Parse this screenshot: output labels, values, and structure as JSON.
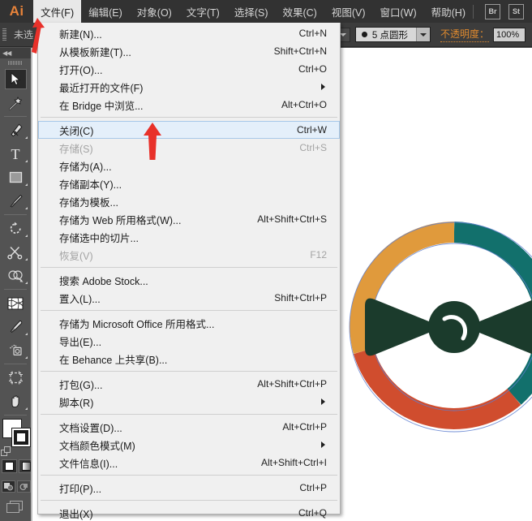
{
  "app": {
    "logo": "Ai",
    "accent_orange": "#e8833a"
  },
  "menubar": {
    "items": [
      {
        "label": "文件(F)",
        "active": true
      },
      {
        "label": "编辑(E)",
        "active": false
      },
      {
        "label": "对象(O)",
        "active": false
      },
      {
        "label": "文字(T)",
        "active": false
      },
      {
        "label": "选择(S)",
        "active": false
      },
      {
        "label": "效果(C)",
        "active": false
      },
      {
        "label": "视图(V)",
        "active": false
      },
      {
        "label": "窗口(W)",
        "active": false
      },
      {
        "label": "帮助(H)",
        "active": false
      }
    ],
    "bridge_button": "Br",
    "stock_button": "St"
  },
  "controlbar": {
    "status": "未选",
    "brush_label": "5 点圆形",
    "opacity_label": "不透明度：",
    "opacity_value": "100%"
  },
  "toolpanel": {
    "collapse": "◀◀",
    "tools": [
      {
        "name": "selection-tool",
        "selected": true,
        "hasflyout": false
      },
      {
        "name": "magic-wand-tool",
        "selected": false,
        "hasflyout": false
      },
      {
        "name": "pen-tool",
        "selected": false,
        "hasflyout": true
      },
      {
        "name": "type-tool",
        "selected": false,
        "hasflyout": true
      },
      {
        "name": "rectangle-tool",
        "selected": false,
        "hasflyout": true
      },
      {
        "name": "paintbrush-tool",
        "selected": false,
        "hasflyout": true
      },
      {
        "name": "rotate-tool",
        "selected": false,
        "hasflyout": true
      },
      {
        "name": "scissors-tool",
        "selected": false,
        "hasflyout": true
      },
      {
        "name": "shape-builder-tool",
        "selected": false,
        "hasflyout": true
      },
      {
        "name": "mesh-tool",
        "selected": false,
        "hasflyout": false
      },
      {
        "name": "eyedropper-tool",
        "selected": false,
        "hasflyout": true
      },
      {
        "name": "blend-tool",
        "selected": false,
        "hasflyout": true
      },
      {
        "name": "artboard-tool",
        "selected": false,
        "hasflyout": false
      },
      {
        "name": "hand-tool",
        "selected": false,
        "hasflyout": true
      }
    ],
    "fill_color": "#ffffff",
    "stroke_color": "#ffffff"
  },
  "filemenu": {
    "items": [
      {
        "label": "新建(N)...",
        "accel": "Ctrl+N",
        "disabled": false,
        "highlight": false,
        "submenu": false
      },
      {
        "label": "从模板新建(T)...",
        "accel": "Shift+Ctrl+N",
        "disabled": false,
        "highlight": false,
        "submenu": false
      },
      {
        "label": "打开(O)...",
        "accel": "Ctrl+O",
        "disabled": false,
        "highlight": false,
        "submenu": false
      },
      {
        "label": "最近打开的文件(F)",
        "accel": "",
        "disabled": false,
        "highlight": false,
        "submenu": true
      },
      {
        "label": "在 Bridge 中浏览...",
        "accel": "Alt+Ctrl+O",
        "disabled": false,
        "highlight": false,
        "submenu": false
      },
      {
        "separator": true
      },
      {
        "label": "关闭(C)",
        "accel": "Ctrl+W",
        "disabled": false,
        "highlight": true,
        "submenu": false
      },
      {
        "label": "存储(S)",
        "accel": "Ctrl+S",
        "disabled": true,
        "highlight": false,
        "submenu": false
      },
      {
        "label": "存储为(A)...",
        "accel": "",
        "disabled": false,
        "highlight": false,
        "submenu": false
      },
      {
        "label": "存储副本(Y)...",
        "accel": "",
        "disabled": false,
        "highlight": false,
        "submenu": false
      },
      {
        "label": "存储为模板...",
        "accel": "",
        "disabled": false,
        "highlight": false,
        "submenu": false
      },
      {
        "label": "存储为 Web 所用格式(W)...",
        "accel": "Alt+Shift+Ctrl+S",
        "disabled": false,
        "highlight": false,
        "submenu": false
      },
      {
        "label": "存储选中的切片...",
        "accel": "",
        "disabled": false,
        "highlight": false,
        "submenu": false
      },
      {
        "label": "恢复(V)",
        "accel": "F12",
        "disabled": true,
        "highlight": false,
        "submenu": false
      },
      {
        "separator": true
      },
      {
        "label": "搜索 Adobe Stock...",
        "accel": "",
        "disabled": false,
        "highlight": false,
        "submenu": false
      },
      {
        "label": "置入(L)...",
        "accel": "Shift+Ctrl+P",
        "disabled": false,
        "highlight": false,
        "submenu": false
      },
      {
        "separator": true
      },
      {
        "label": "存储为 Microsoft Office 所用格式...",
        "accel": "",
        "disabled": false,
        "highlight": false,
        "submenu": false
      },
      {
        "label": "导出(E)...",
        "accel": "",
        "disabled": false,
        "highlight": false,
        "submenu": false
      },
      {
        "label": "在 Behance 上共享(B)...",
        "accel": "",
        "disabled": false,
        "highlight": false,
        "submenu": false
      },
      {
        "separator": true
      },
      {
        "label": "打包(G)...",
        "accel": "Alt+Shift+Ctrl+P",
        "disabled": false,
        "highlight": false,
        "submenu": false
      },
      {
        "label": "脚本(R)",
        "accel": "",
        "disabled": false,
        "highlight": false,
        "submenu": true
      },
      {
        "separator": true
      },
      {
        "label": "文档设置(D)...",
        "accel": "Alt+Ctrl+P",
        "disabled": false,
        "highlight": false,
        "submenu": false
      },
      {
        "label": "文档颜色模式(M)",
        "accel": "",
        "disabled": false,
        "highlight": false,
        "submenu": true
      },
      {
        "label": "文件信息(I)...",
        "accel": "Alt+Shift+Ctrl+I",
        "disabled": false,
        "highlight": false,
        "submenu": false
      },
      {
        "separator": true
      },
      {
        "label": "打印(P)...",
        "accel": "Ctrl+P",
        "disabled": false,
        "highlight": false,
        "submenu": false
      },
      {
        "separator": true
      },
      {
        "label": "退出(X)",
        "accel": "Ctrl+Q",
        "disabled": false,
        "highlight": false,
        "submenu": false
      }
    ]
  },
  "artwork": {
    "description": "bow-tie donut logo",
    "donut_segments": [
      {
        "name": "teal",
        "color": "#12706c",
        "start_deg": 0,
        "sweep_deg": 160
      },
      {
        "name": "red",
        "color": "#d04d2e",
        "start_deg": 160,
        "sweep_deg": 95
      },
      {
        "name": "orange",
        "color": "#e09a3c",
        "start_deg": 255,
        "sweep_deg": 105
      }
    ],
    "bowtie_color": "#1b3b2c"
  },
  "annotations": {
    "arrow_color": "#e8312a",
    "arrows": [
      {
        "name": "arrow-to-file-menu",
        "points_to": "文件(F)"
      },
      {
        "name": "arrow-to-close-item",
        "points_to": "关闭(C)"
      }
    ]
  }
}
